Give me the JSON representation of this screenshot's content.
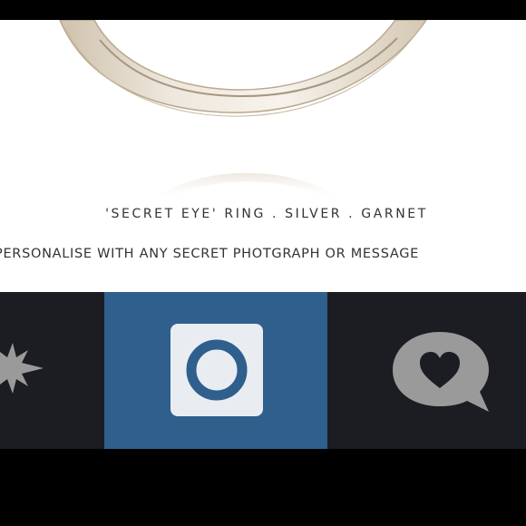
{
  "product": {
    "title": "'SECRET EYE' RING  .  SILVER  .  GARNET",
    "subtitle": "PERSONALISE WITH ANY SECRET PHOTGRAPH OR MESSAGE",
    "image": "silver-ring-photo"
  },
  "nav": {
    "tabs": [
      {
        "icon": "starburst-icon",
        "active": false
      },
      {
        "icon": "app-logo-icon",
        "active": true
      },
      {
        "icon": "heart-chat-bubble-icon",
        "active": false
      }
    ],
    "colors": {
      "active_bg": "#2f5f8c",
      "inactive_bg": "#1b1d22",
      "icon_gray": "#9a9a9a",
      "logo_square": "#e9edf2"
    }
  }
}
